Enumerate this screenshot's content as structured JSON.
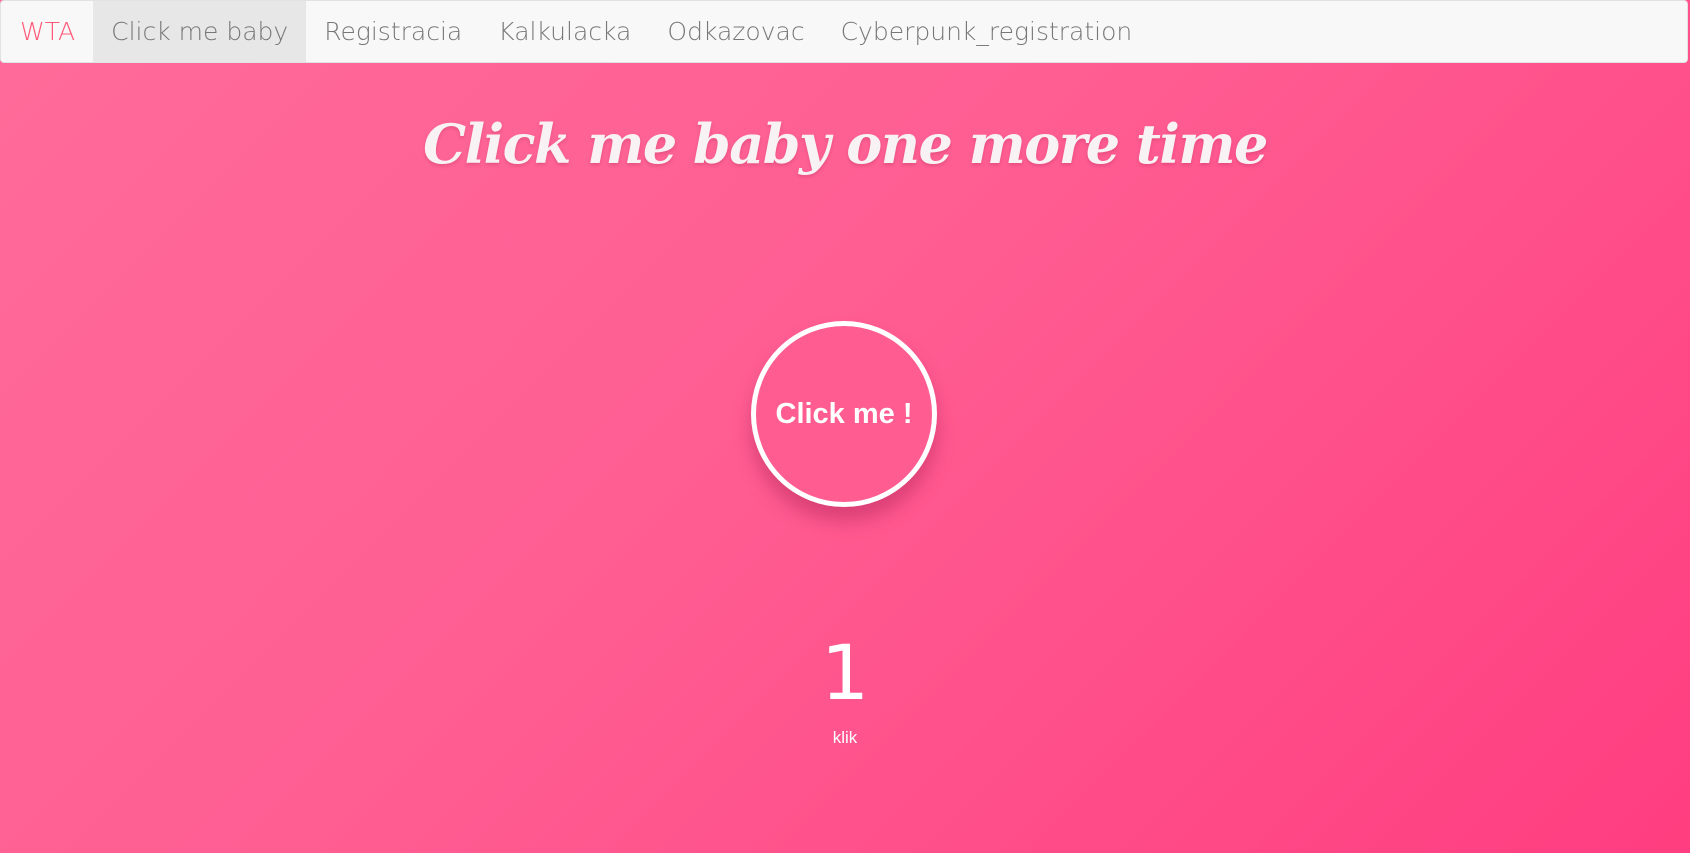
{
  "nav": {
    "brand": "WTA",
    "items": [
      {
        "label": "Click me baby",
        "active": true
      },
      {
        "label": "Registracia",
        "active": false
      },
      {
        "label": "Kalkulacka",
        "active": false
      },
      {
        "label": "Odkazovac",
        "active": false
      },
      {
        "label": "Cyberpunk_registration",
        "active": false
      }
    ]
  },
  "main": {
    "title": "Click me baby one more time",
    "button_label": "Click me !",
    "count": "1",
    "count_label": "klik"
  },
  "colors": {
    "brand": "#ff5a78",
    "background_start": "#ff6b9a",
    "background_end": "#ff3d80",
    "navbar_bg": "#f8f8f8",
    "active_tab_bg": "#e7e7e7"
  }
}
